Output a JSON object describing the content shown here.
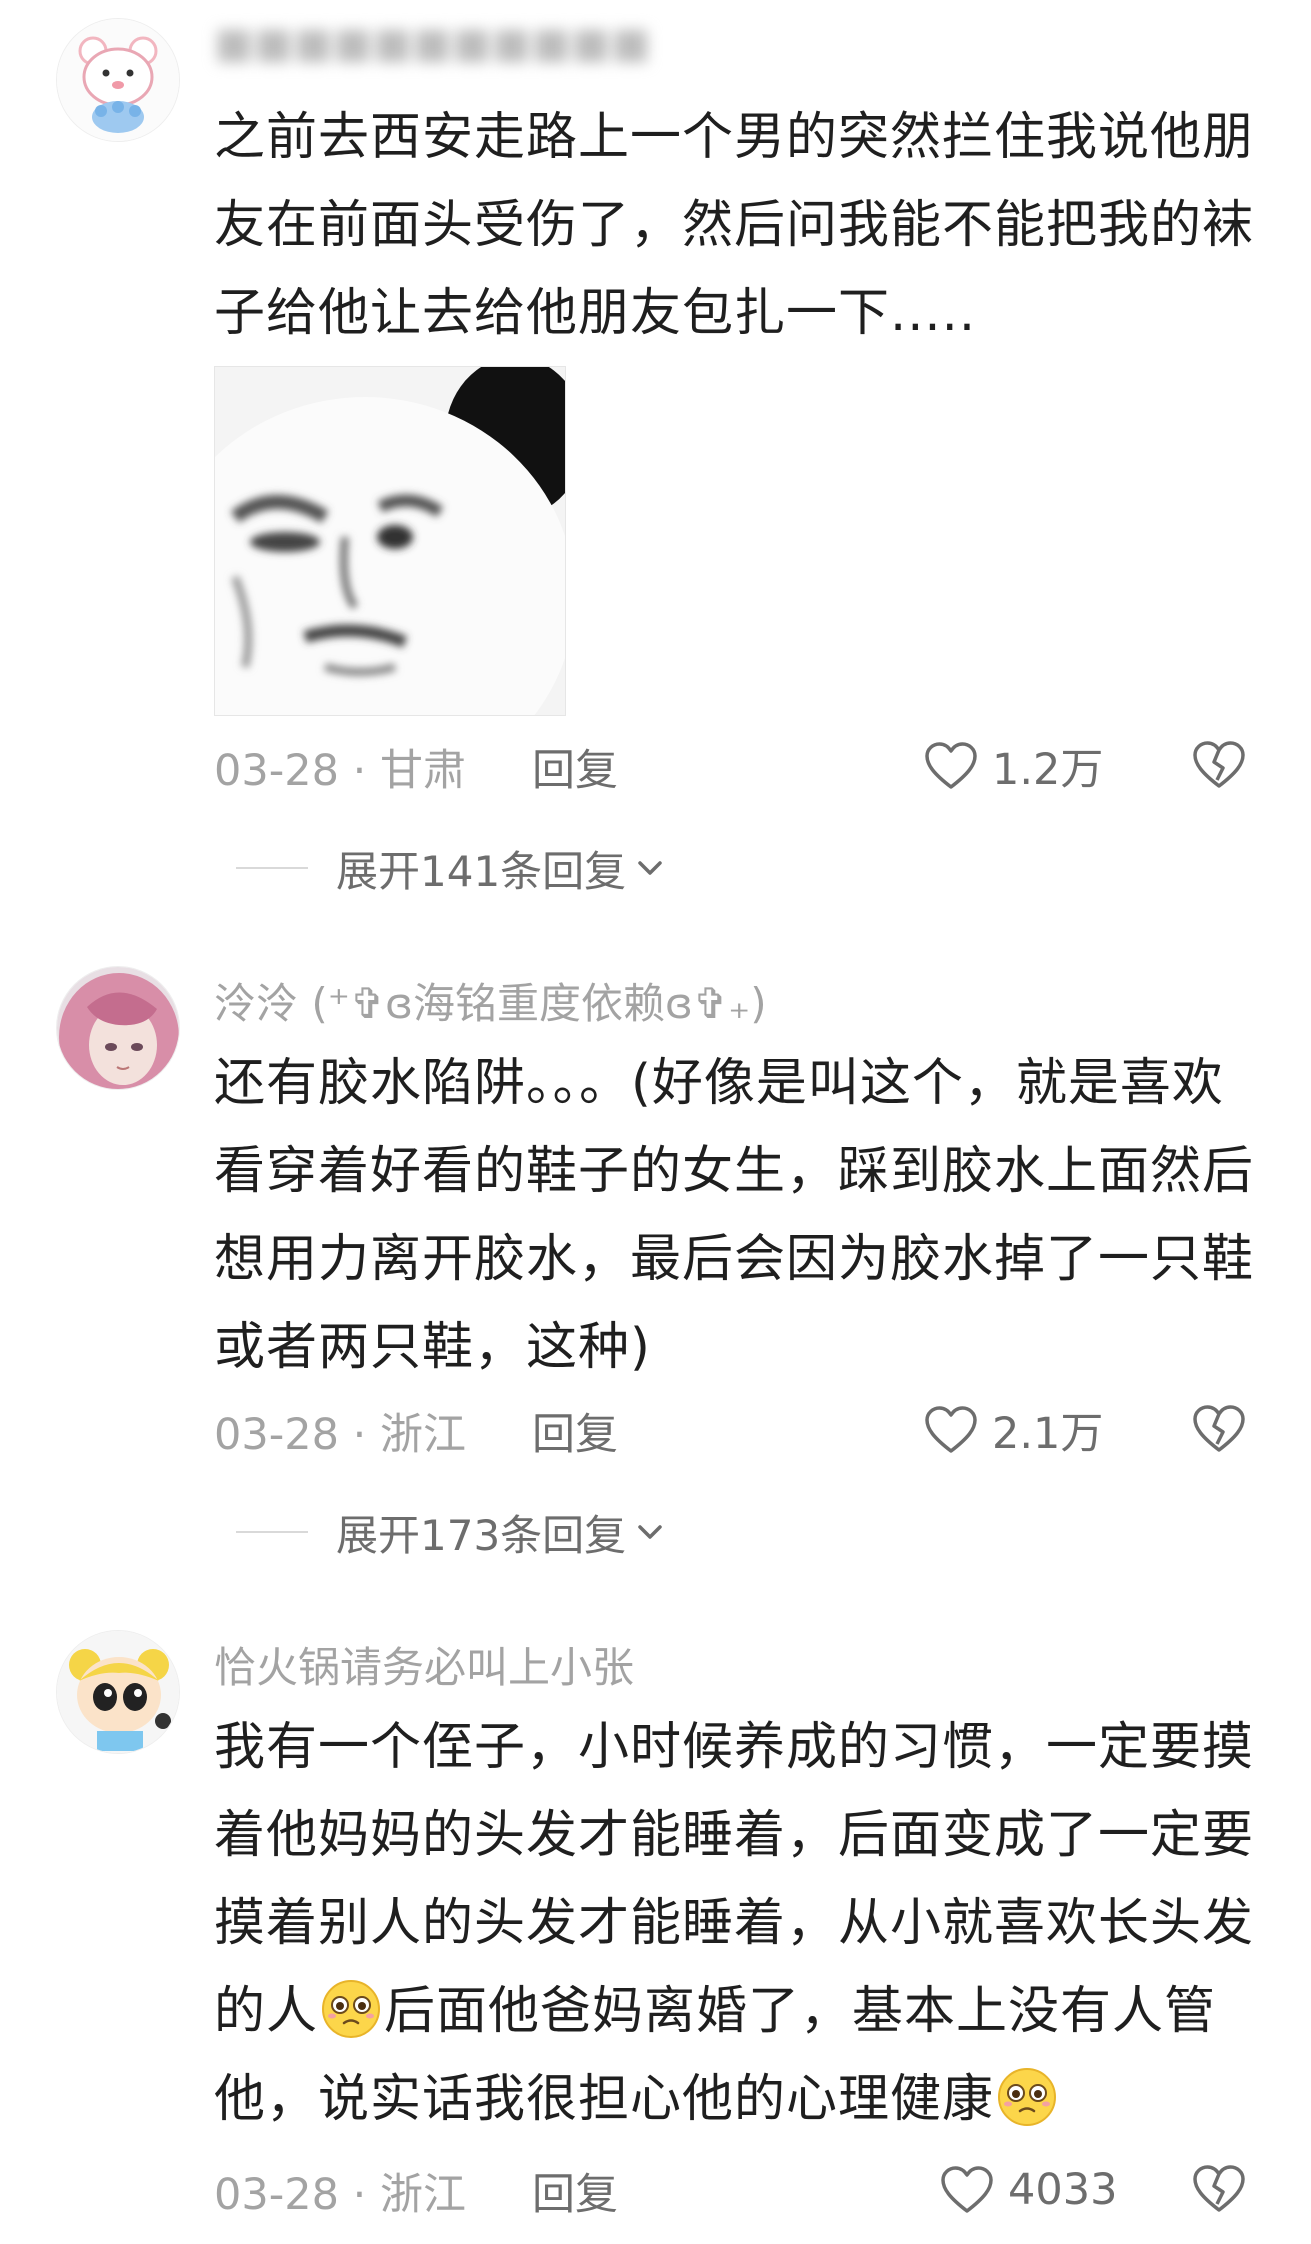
{
  "comments": [
    {
      "username": "■■■■■■■■■■■",
      "text": "之前去西安走路上一个男的突然拦住我说他朋友在前面头受伤了，然后问我能不能把我的袜子给他让去给他朋友包扎一下.....",
      "date_location": "03-28 · 甘肃",
      "reply_label": "回复",
      "likes": "1.2万",
      "expand_label": "展开141条回复"
    },
    {
      "username": "泠泠 (⁺✞ɞ海铭重度依赖ɞ✞₊)",
      "text": "还有胶水陷阱。。。(好像是叫这个，就是喜欢看穿着好看的鞋子的女生，踩到胶水上面然后想用力离开胶水，最后会因为胶水掉了一只鞋或者两只鞋，这种)",
      "date_location": "03-28 · 浙江",
      "reply_label": "回复",
      "likes": "2.1万",
      "expand_label": "展开173条回复"
    },
    {
      "username": "恰火锅请务必叫上小张",
      "text_part1": "我有一个侄子，小时候养成的习惯，一定要摸着他妈妈的头发才能睡着，后面变成了一定要摸着别人的头发才能睡着，从小就喜欢长头发的人",
      "text_part2": "后面他爸妈离婚了，基本上没有人管他，说实话我很担心他的心理健康",
      "date_location": "03-28 · 浙江",
      "reply_label": "回复",
      "likes": "4033"
    }
  ],
  "icons": {
    "like": "heart-outline-icon",
    "dislike": "broken-heart-icon",
    "expand": "chevron-down-icon",
    "emoji": "pleading-face-emoji"
  },
  "colors": {
    "text": "#1f1f1f",
    "secondary": "#a3a3a3",
    "action": "#6d6d6d"
  }
}
